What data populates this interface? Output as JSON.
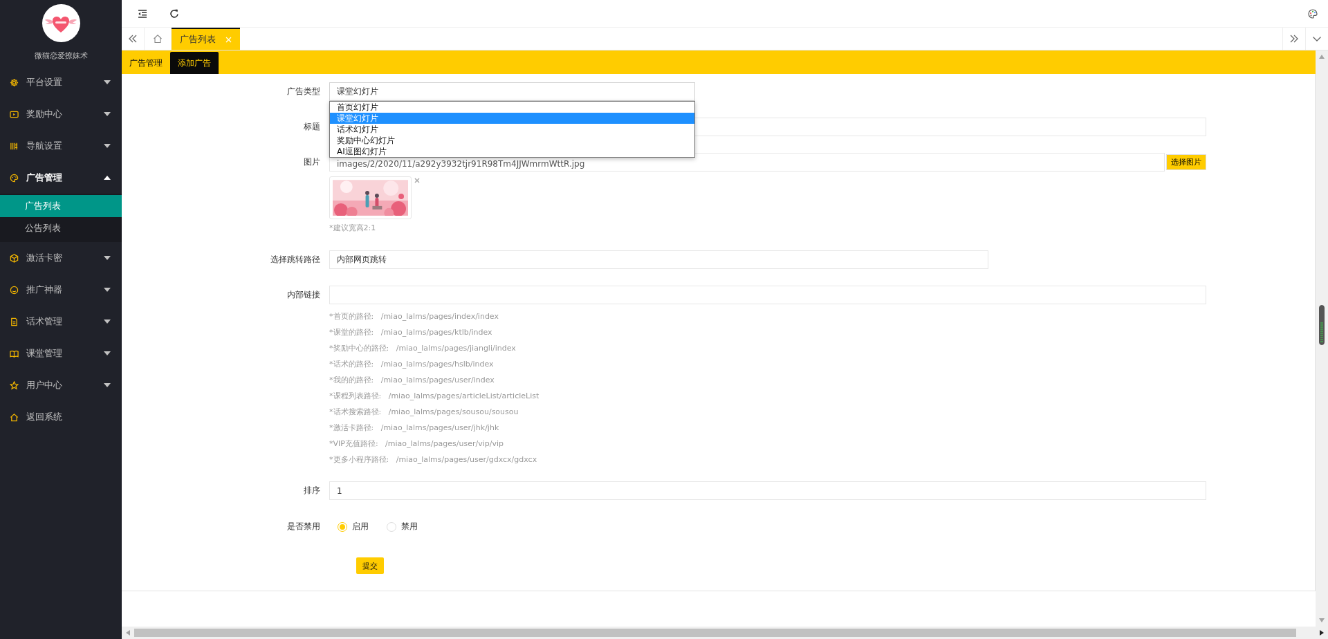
{
  "sidebar": {
    "brand": "微猫恋爱撩妹术",
    "items": [
      {
        "label": "平台设置",
        "kind": "group",
        "expanded": false
      },
      {
        "label": "奖励中心",
        "kind": "group",
        "expanded": false
      },
      {
        "label": "导航设置",
        "kind": "group",
        "expanded": false
      },
      {
        "label": "广告管理",
        "kind": "group",
        "expanded": true,
        "children": [
          {
            "label": "广告列表",
            "selected": true
          },
          {
            "label": "公告列表",
            "selected": false
          }
        ]
      },
      {
        "label": "激活卡密",
        "kind": "group",
        "expanded": false
      },
      {
        "label": "推广神器",
        "kind": "group",
        "expanded": false
      },
      {
        "label": "话术管理",
        "kind": "group",
        "expanded": false
      },
      {
        "label": "课堂管理",
        "kind": "group",
        "expanded": false
      },
      {
        "label": "用户中心",
        "kind": "group",
        "expanded": false
      },
      {
        "label": "返回系统",
        "kind": "link"
      }
    ]
  },
  "tabs": [
    {
      "label": "广告列表",
      "selected": true
    }
  ],
  "page_tabs": [
    {
      "label": "广告管理",
      "selected": false
    },
    {
      "label": "添加广告",
      "selected": true
    }
  ],
  "form": {
    "fields": [
      {
        "kind": "select",
        "label": "广告类型",
        "value": "课堂幻灯片",
        "expanded": true,
        "options": [
          {
            "label": "首页幻灯片",
            "selected": false
          },
          {
            "label": "课堂幻灯片",
            "selected": true
          },
          {
            "label": "话术幻灯片",
            "selected": false
          },
          {
            "label": "奖励中心幻灯片",
            "selected": false
          },
          {
            "label": "AI逗图幻灯片",
            "selected": false
          }
        ]
      },
      {
        "kind": "text",
        "label": "标题"
      },
      {
        "label": "图片",
        "value": "images/2/2020/11/a292y3932tjr91R98Tm4JJWmrmWttR.jpg",
        "button": "选择图片",
        "hint": "*建议宽高2:1"
      },
      {
        "kind": "select",
        "label": "选择跳转路径",
        "value": "内部网页跳转"
      },
      {
        "kind": "text",
        "label": "内部链接",
        "hints": [
          "*首页的路径:   /miao_lalms/pages/index/index",
          "*课堂的路径:   /miao_lalms/pages/ktlb/index",
          "*奖励中心的路径:   /miao_lalms/pages/jiangli/index",
          "*话术的路径:   /miao_lalms/pages/hslb/index",
          "*我的的路径:   /miao_lalms/pages/user/index",
          "*课程列表路径:   /miao_lalms/pages/articleList/articleList",
          "*话术搜索路径:   /miao_lalms/pages/sousou/sousou",
          "*激活卡路径:   /miao_lalms/pages/user/jhk/jhk",
          "*VIP充值路径:   /miao_lalms/pages/user/vip/vip",
          "*更多小程序路径:   /miao_lalms/pages/user/gdxcx/gdxcx"
        ]
      },
      {
        "kind": "text",
        "label": "排序",
        "value": "1"
      },
      {
        "kind": "radio",
        "label": "是否禁用",
        "options": [
          {
            "label": "启用",
            "selected": true
          },
          {
            "label": "禁用",
            "selected": false
          }
        ]
      }
    ],
    "submit": "提交"
  }
}
